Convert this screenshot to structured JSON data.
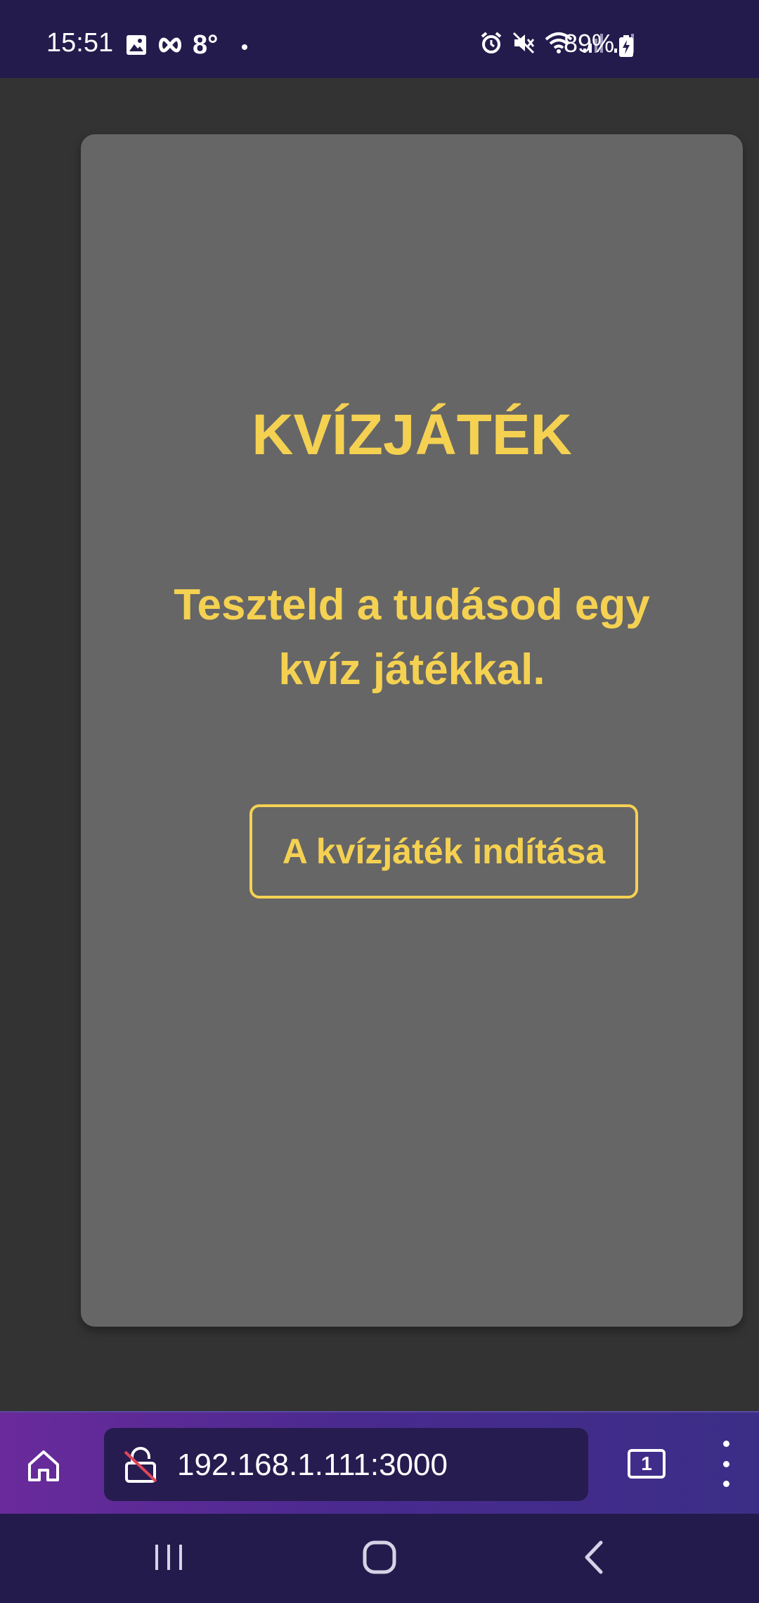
{
  "status_bar": {
    "time": "15:51",
    "temperature": "8°",
    "battery": "89%",
    "icons": [
      "image-icon",
      "infinity-icon",
      "alarm-icon",
      "mute-icon",
      "wifi-icon",
      "signal-icon",
      "signal-icon-2",
      "battery-charging-icon"
    ]
  },
  "quiz": {
    "title": "KVÍZJÁTÉK",
    "subtitle": "Teszteld a tudásod egy kvíz játékkal.",
    "start_button": "A kvízjáték indítása"
  },
  "browser": {
    "url": "192.168.1.111:3000",
    "tab_count": "1",
    "icons": [
      "home-icon",
      "not-secure-lock-icon",
      "tabs-icon",
      "more-menu-icon"
    ]
  },
  "colors": {
    "accent": "#f5d152",
    "card": "#666666",
    "background": "#333333",
    "status_bar": "#241b4d"
  },
  "nav": {
    "icons": [
      "recent-apps-icon",
      "home-button-icon",
      "back-icon"
    ]
  }
}
